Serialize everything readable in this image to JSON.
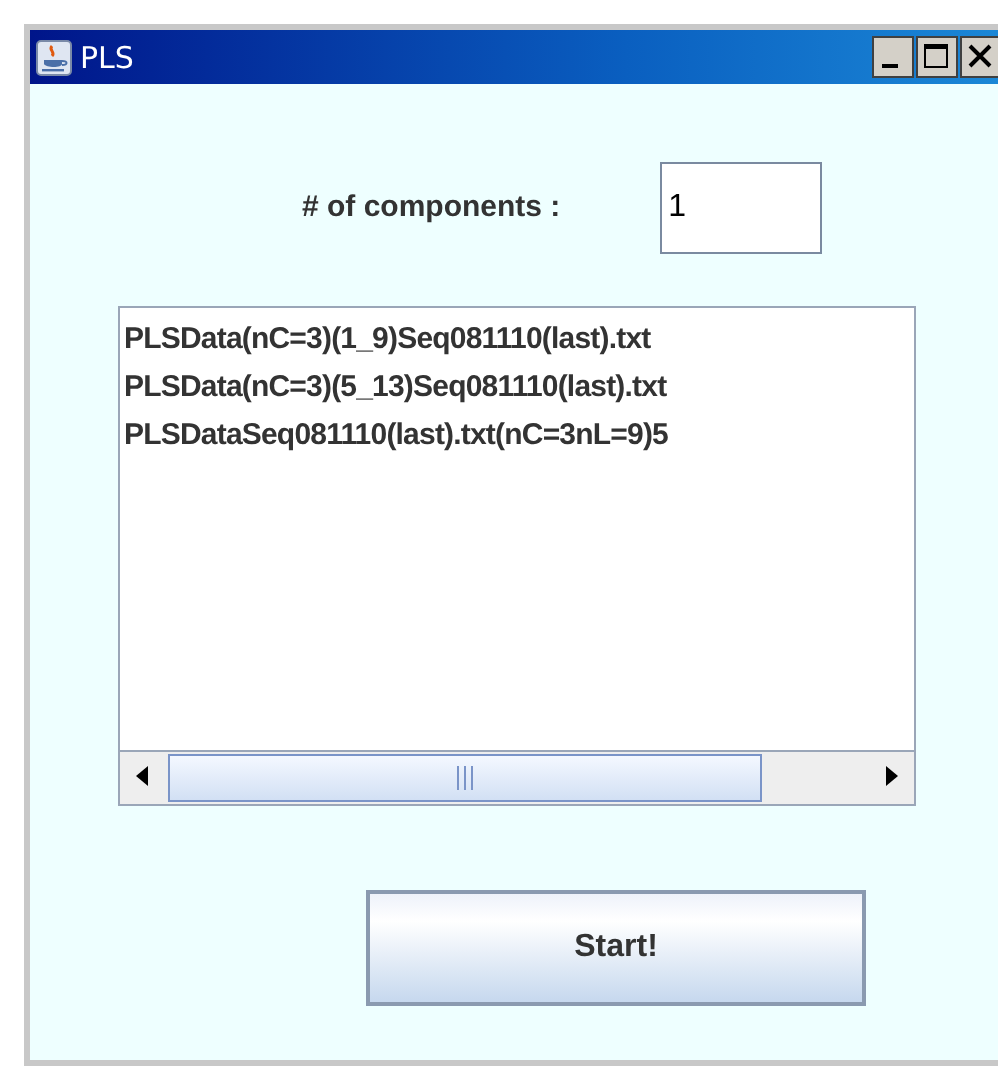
{
  "window": {
    "title": "PLS"
  },
  "components": {
    "label": "# of components :",
    "value": "1"
  },
  "files": [
    {
      "name": "PLSData(nC=3)(1_9)Seq081110(last).txt"
    },
    {
      "name": "PLSData(nC=3)(5_13)Seq081110(last).txt"
    },
    {
      "name": "PLSDataSeq081110(last).txt(nC=3nL=9)5"
    }
  ],
  "buttons": [
    {
      "label": "Start!"
    }
  ]
}
